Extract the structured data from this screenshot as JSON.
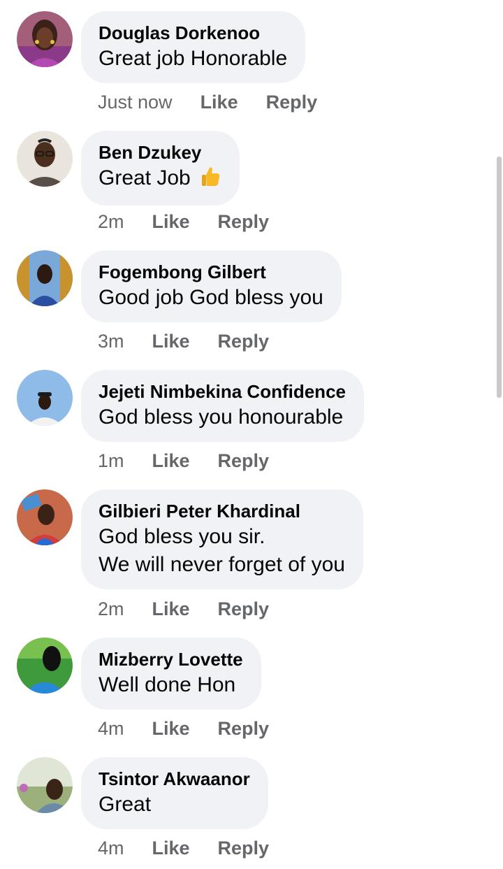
{
  "comments": [
    {
      "name": "Douglas Dorkenoo",
      "lines": [
        "Great job Honorable"
      ],
      "time": "Just now",
      "like": "Like",
      "reply": "Reply",
      "emoji": ""
    },
    {
      "name": "Ben Dzukey",
      "lines": [
        "Great Job"
      ],
      "time": "2m",
      "like": "Like",
      "reply": "Reply",
      "emoji": "thumbs-up"
    },
    {
      "name": "Fogembong Gilbert",
      "lines": [
        "Good job God bless you"
      ],
      "time": "3m",
      "like": "Like",
      "reply": "Reply",
      "emoji": ""
    },
    {
      "name": "Jejeti Nimbekina Confidence",
      "lines": [
        "God bless you honourable"
      ],
      "time": "1m",
      "like": "Like",
      "reply": "Reply",
      "emoji": ""
    },
    {
      "name": "Gilbieri Peter Khardinal",
      "lines": [
        "God bless you sir.",
        "We will never forget of you"
      ],
      "time": "2m",
      "like": "Like",
      "reply": "Reply",
      "emoji": ""
    },
    {
      "name": "Mizberry Lovette",
      "lines": [
        "Well done Hon"
      ],
      "time": "4m",
      "like": "Like",
      "reply": "Reply",
      "emoji": ""
    },
    {
      "name": "Tsintor Akwaanor",
      "lines": [
        "Great"
      ],
      "time": "4m",
      "like": "Like",
      "reply": "Reply",
      "emoji": ""
    }
  ],
  "colors": {
    "bubble": "#f0f2f5",
    "name_text": "#050505",
    "action_text": "#65676b",
    "scrollbar": "#c9c9c9"
  }
}
